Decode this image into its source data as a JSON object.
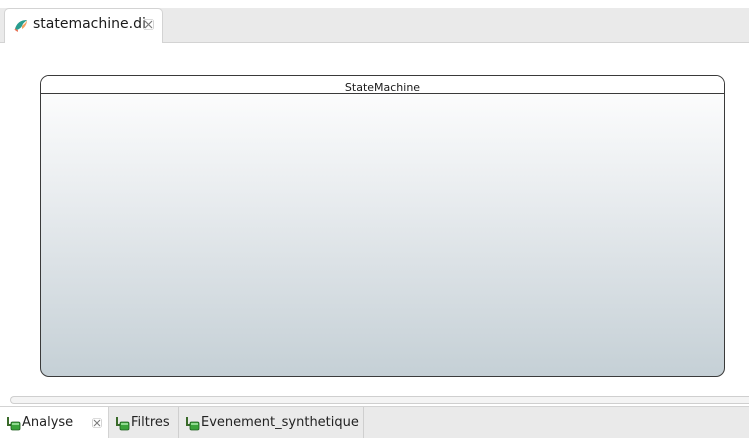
{
  "editor": {
    "tab_label": "statemachine.di",
    "tab_icon": "papyrus-diagram-icon"
  },
  "diagram": {
    "node_title": "StateMachine",
    "node_colors": {
      "gradient_top": "#ffffff",
      "gradient_bottom": "#c5d0d6",
      "border": "#3a3a3a"
    }
  },
  "views": {
    "tabs": [
      {
        "label": "Analyse",
        "icon": "view-tree-icon",
        "active": true
      },
      {
        "label": "Filtres",
        "icon": "view-tree-icon",
        "active": false
      },
      {
        "label": "Evenement_synthetique",
        "icon": "view-tree-icon",
        "active": false
      }
    ]
  }
}
